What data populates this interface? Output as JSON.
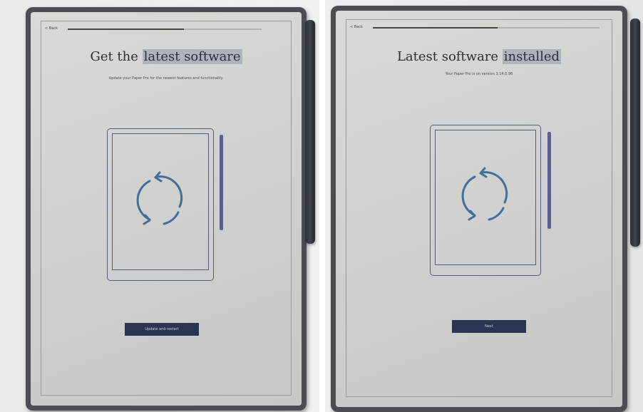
{
  "left_screen": {
    "back_label": "< Back",
    "progress_fraction": 0.6,
    "title_plain": "Get the ",
    "title_highlight": "latest software",
    "subtitle": "Update your Paper Pro for the newest features and functionality.",
    "icon": "sync-icon",
    "button_label": "Update and restart"
  },
  "right_screen": {
    "back_label": "< Back",
    "progress_fraction": 0.55,
    "title_plain": "Latest software ",
    "title_highlight": "installed",
    "subtitle": "Your Paper Pro is on version 3.14.0.96",
    "icon": "sync-icon",
    "button_label": "Next"
  },
  "colors": {
    "device_bezel": "#4b4d52",
    "screen": "#d4d5d2",
    "button": "#2a3553",
    "illustration_stroke": "#555c78",
    "sync_arrow": "#3f6f9a",
    "title_highlight": "#aeb3bd"
  }
}
